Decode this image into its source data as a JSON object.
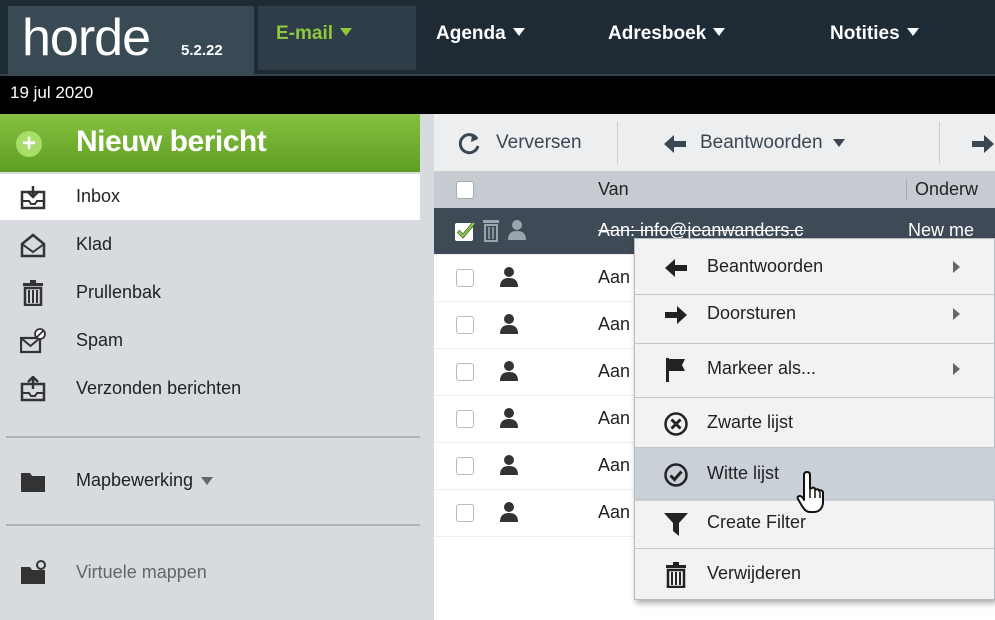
{
  "app": {
    "logo": "horde",
    "version": "5.2.22"
  },
  "nav": {
    "email": "E-mail",
    "agenda": "Agenda",
    "adresboek": "Adresboek",
    "notities": "Notities"
  },
  "date": "19 jul 2020",
  "sidebar": {
    "new_message": "Nieuw bericht",
    "folders": [
      {
        "label": "Inbox",
        "icon": "inbox-icon"
      },
      {
        "label": "Klad",
        "icon": "drafts-icon"
      },
      {
        "label": "Prullenbak",
        "icon": "trash-icon"
      },
      {
        "label": "Spam",
        "icon": "spam-icon"
      },
      {
        "label": "Verzonden berichten",
        "icon": "sent-icon"
      }
    ],
    "folder_actions": "Mapbewerking",
    "virtual_folders": "Virtuele mappen"
  },
  "toolbar": {
    "refresh": "Verversen",
    "reply": "Beantwoorden"
  },
  "list": {
    "col_from": "Van",
    "col_subject": "Onderw",
    "rows": [
      {
        "from": "Aan: info@jeanwanders.c",
        "subject": "New me",
        "selected": true
      },
      {
        "from": "Aan"
      },
      {
        "from": "Aan"
      },
      {
        "from": "Aan"
      },
      {
        "from": "Aan"
      },
      {
        "from": "Aan"
      },
      {
        "from": "Aan"
      }
    ]
  },
  "context_menu": {
    "items": [
      {
        "label": "Beantwoorden",
        "icon": "reply-arrow-icon",
        "submenu": true
      },
      {
        "label": "Doorsturen",
        "icon": "forward-arrow-icon",
        "submenu": true
      },
      {
        "label": "Markeer als...",
        "icon": "flag-icon",
        "submenu": true
      },
      {
        "label": "Zwarte lijst",
        "icon": "blacklist-icon"
      },
      {
        "label": "Witte lijst",
        "icon": "whitelist-icon",
        "hovered": true
      },
      {
        "label": "Create Filter",
        "icon": "filter-icon"
      },
      {
        "label": "Verwijderen",
        "icon": "trash-icon"
      }
    ]
  },
  "colors": {
    "accent_green": "#8fc73e",
    "top_bar": "#1e2a34",
    "selected_row": "#3e4a56",
    "sidebar_bg": "#d7dade"
  }
}
